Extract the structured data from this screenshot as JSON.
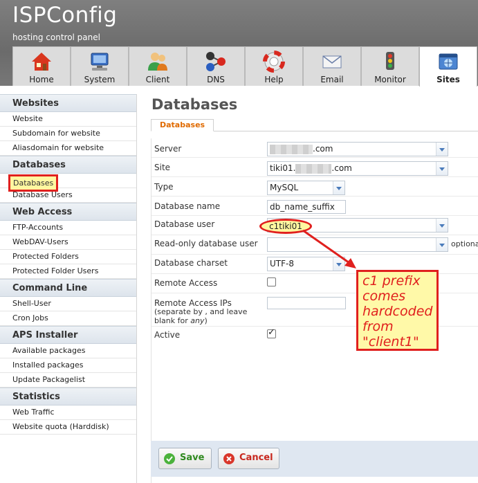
{
  "app": {
    "logo": "ISPConfig",
    "tagline": "hosting control panel"
  },
  "tabs": [
    {
      "label": "Home",
      "icon": "home-icon"
    },
    {
      "label": "System",
      "icon": "computer-icon"
    },
    {
      "label": "Client",
      "icon": "users-icon"
    },
    {
      "label": "DNS",
      "icon": "dns-network-icon"
    },
    {
      "label": "Help",
      "icon": "lifebuoy-icon"
    },
    {
      "label": "Email",
      "icon": "envelope-icon"
    },
    {
      "label": "Monitor",
      "icon": "traffic-light-icon"
    },
    {
      "label": "Sites",
      "icon": "sites-globe-icon",
      "active": true
    }
  ],
  "sidebar": {
    "sections": [
      {
        "title": "Websites",
        "items": [
          "Website",
          "Subdomain for website",
          "Aliasdomain for website"
        ]
      },
      {
        "title": "Databases",
        "items": [
          "Databases",
          "Database Users"
        ]
      },
      {
        "title": "Web Access",
        "items": [
          "FTP-Accounts",
          "WebDAV-Users",
          "Protected Folders",
          "Protected Folder Users"
        ]
      },
      {
        "title": "Command Line",
        "items": [
          "Shell-User",
          "Cron Jobs"
        ]
      },
      {
        "title": "APS Installer",
        "items": [
          "Available packages",
          "Installed packages",
          "Update Packagelist"
        ]
      },
      {
        "title": "Statistics",
        "items": [
          "Web Traffic",
          "Website quota (Harddisk)"
        ]
      }
    ],
    "highlighted_item": "Databases"
  },
  "main": {
    "title": "Databases",
    "subtab": "Databases"
  },
  "form": {
    "server": {
      "label": "Server",
      "value_suffix": ".com"
    },
    "site": {
      "label": "Site",
      "value_prefix": "tiki01.",
      "value_suffix": ".com"
    },
    "type": {
      "label": "Type",
      "value": "MySQL"
    },
    "database_name": {
      "label": "Database name",
      "value": "db_name_suffix"
    },
    "database_user": {
      "label": "Database user",
      "value": "c1tiki01"
    },
    "readonly_user": {
      "label": "Read-only database user",
      "value": "",
      "note": "optiona"
    },
    "charset": {
      "label": "Database charset",
      "value": "UTF-8"
    },
    "remote_access": {
      "label": "Remote Access",
      "checked": false
    },
    "remote_ips": {
      "label_line1": "Remote Access IPs",
      "label_line2": "(separate by , and leave",
      "label_line3_a": "blank for ",
      "label_line3_b": "any",
      "label_line3_c": ")",
      "value": ""
    },
    "active": {
      "label": "Active",
      "checked": true
    }
  },
  "annotation": {
    "callout_text_lines": [
      "c1 prefix",
      "comes",
      "hardcoded",
      "from",
      "\"client1\""
    ],
    "color": "#e0201e",
    "background": "#fff9a8"
  },
  "buttons": {
    "save": "Save",
    "cancel": "Cancel"
  }
}
